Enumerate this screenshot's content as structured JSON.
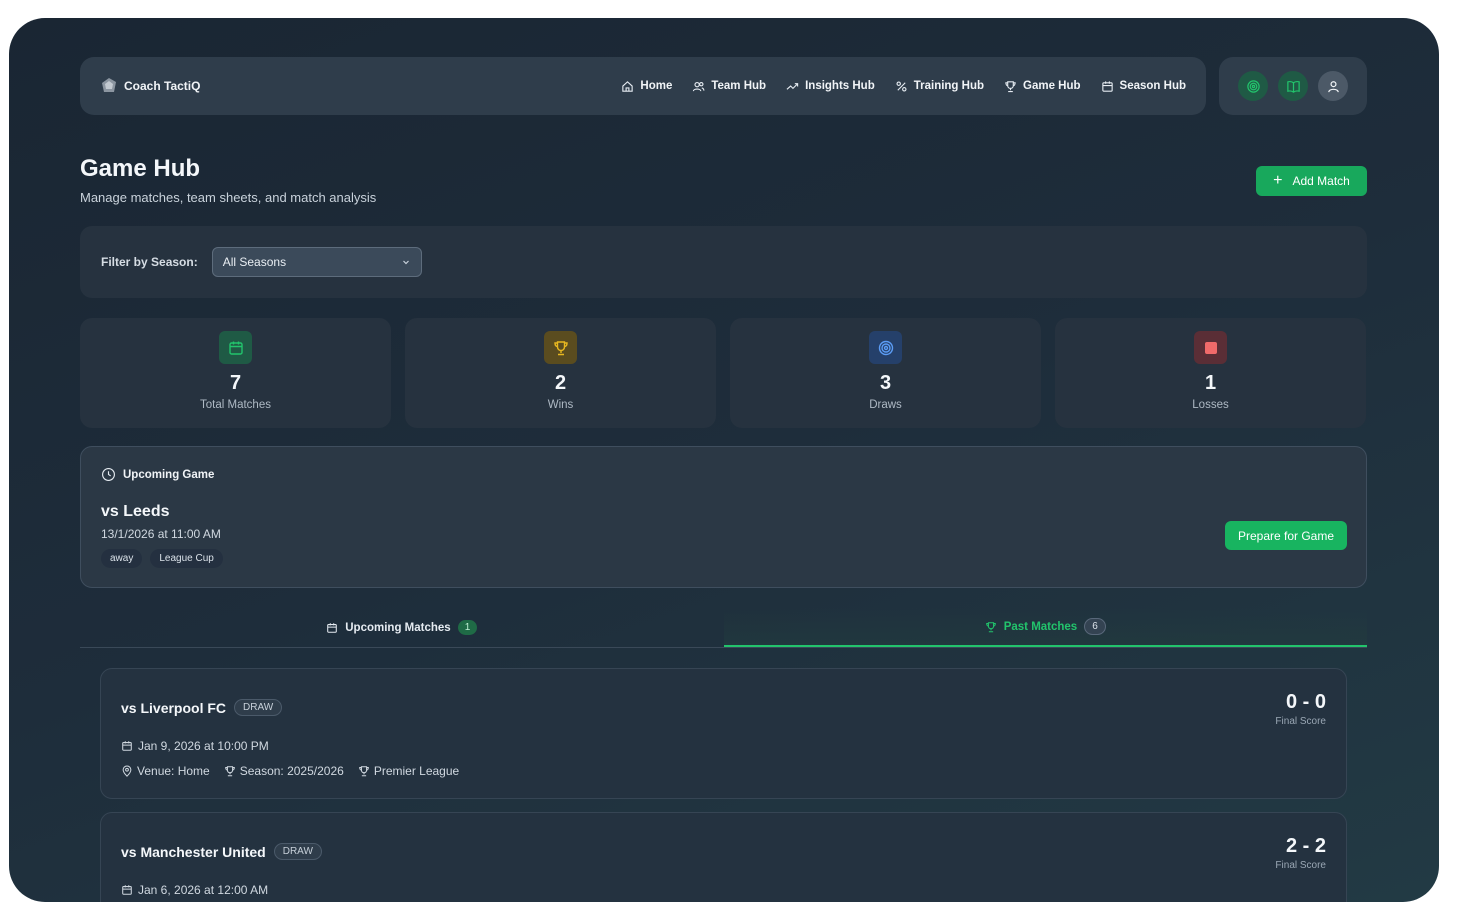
{
  "app": {
    "name": "Coach TactiQ"
  },
  "nav": {
    "links": [
      {
        "label": "Home",
        "icon": "home-icon"
      },
      {
        "label": "Team Hub",
        "icon": "users-icon"
      },
      {
        "label": "Insights Hub",
        "icon": "trend-icon"
      },
      {
        "label": "Training Hub",
        "icon": "percent-icon"
      },
      {
        "label": "Game Hub",
        "icon": "trophy-icon"
      },
      {
        "label": "Season Hub",
        "icon": "calendar-icon"
      }
    ],
    "right_buttons": [
      "target-icon",
      "book-icon",
      "user-icon"
    ]
  },
  "header": {
    "title": "Game Hub",
    "subtitle": "Manage matches, team sheets, and match analysis",
    "add_button": "Add Match"
  },
  "filter": {
    "label": "Filter by Season:",
    "selected": "All Seasons"
  },
  "stats": [
    {
      "value": "7",
      "label": "Total Matches",
      "icon": "calendar-icon",
      "color": "#22c46c"
    },
    {
      "value": "2",
      "label": "Wins",
      "icon": "trophy-icon",
      "color": "#e0b020"
    },
    {
      "value": "3",
      "label": "Draws",
      "icon": "target-icon",
      "color": "#4a8cf0"
    },
    {
      "value": "1",
      "label": "Losses",
      "icon": "square-icon",
      "color": "#f06a6a"
    }
  ],
  "upcoming": {
    "heading": "Upcoming Game",
    "opponent": "vs Leeds",
    "datetime": "13/1/2026 at 11:00 AM",
    "tags": [
      "away",
      "League Cup"
    ],
    "button": "Prepare for Game"
  },
  "tabs": [
    {
      "label": "Upcoming Matches",
      "count": "1"
    },
    {
      "label": "Past Matches",
      "count": "6"
    }
  ],
  "matches": [
    {
      "opponent": "vs Liverpool FC",
      "result": "DRAW",
      "date": "Jan 9, 2026 at 10:00 PM",
      "venue": "Venue: Home",
      "season": "Season: 2025/2026",
      "competition": "Premier League",
      "score": "0 - 0",
      "score_label": "Final Score"
    },
    {
      "opponent": "vs Manchester United",
      "result": "DRAW",
      "date": "Jan 6, 2026 at 12:00 AM",
      "score": "2 - 2",
      "score_label": "Final Score"
    }
  ]
}
